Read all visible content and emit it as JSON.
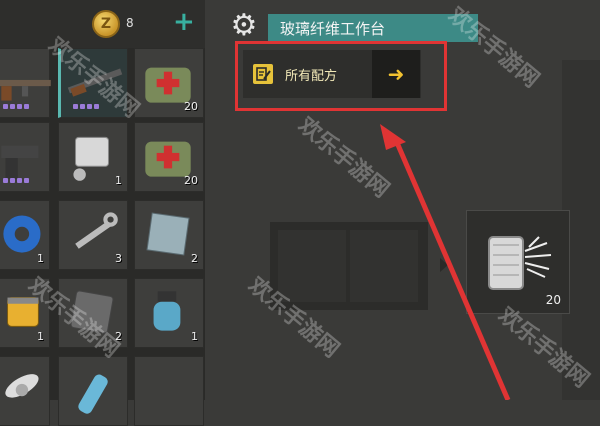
{
  "currency": {
    "amount": "8",
    "coin_icon": "coin-icon",
    "coin_letter": "Z",
    "add_icon": "plus-icon"
  },
  "settings_icon": "gear-icon",
  "workbench": {
    "title": "玻璃纤维工作台",
    "title_bg": "#3d8a86"
  },
  "recipes_button": {
    "label": "所有配方",
    "icon": "recipe-book-icon",
    "arrow_icon": "arrow-right-icon",
    "arrow_glyph": "➜"
  },
  "highlight_color": "#e03434",
  "inventory": [
    {
      "item": "rifle-icon",
      "qty": "",
      "quality_dots": 4
    },
    {
      "item": "shotgun-icon",
      "qty": "",
      "quality_dots": 4,
      "selected": true
    },
    {
      "item": "medkit-icon",
      "qty": "20"
    },
    {
      "item": "pistol-icon",
      "qty": "",
      "quality_dots": 4
    },
    {
      "item": "engine-part-icon",
      "qty": "1"
    },
    {
      "item": "medkit-icon",
      "qty": "20"
    },
    {
      "item": "tape-icon",
      "qty": "1"
    },
    {
      "item": "wrench-icon",
      "qty": "3"
    },
    {
      "item": "metal-plate-icon",
      "qty": "2"
    },
    {
      "item": "filter-icon",
      "qty": "1"
    },
    {
      "item": "stone-plate-icon",
      "qty": "2"
    },
    {
      "item": "water-pump-icon",
      "qty": "1"
    },
    {
      "item": "propeller-icon",
      "qty": ""
    },
    {
      "item": "bottle-icon",
      "qty": ""
    },
    {
      "item": "empty",
      "qty": ""
    }
  ],
  "craft_output": {
    "item": "fiberglass-icon",
    "qty": "20"
  },
  "watermark": "欢乐手游网"
}
